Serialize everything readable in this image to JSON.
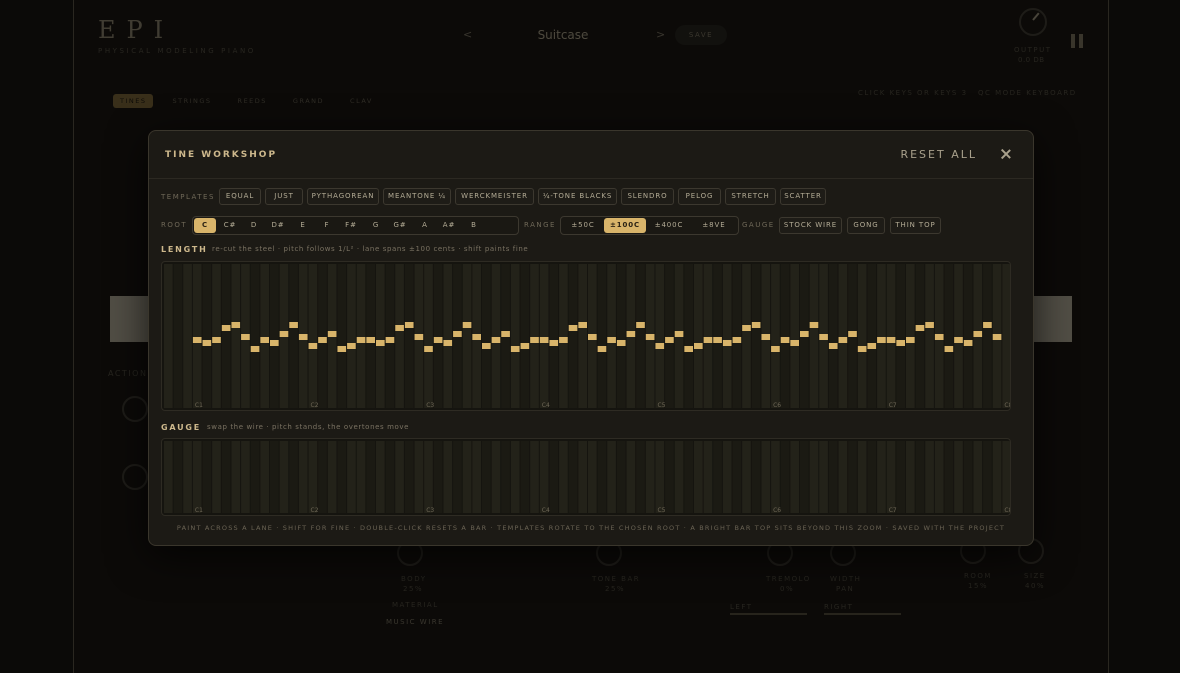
{
  "background": {
    "logo": "EPI",
    "logo_sub": "PHYSICAL MODELING PIANO",
    "preset_prev": "<",
    "preset_next": ">",
    "preset_name": "Suitcase",
    "save_label": "SAVE",
    "output_label": "OUTPUT",
    "output_value": "0.0 dB",
    "categories": [
      {
        "label": "TINES",
        "active": true
      },
      {
        "label": "STRINGS",
        "active": false
      },
      {
        "label": "REEDS",
        "active": false
      },
      {
        "label": "GRAND",
        "active": false
      },
      {
        "label": "CLAV",
        "active": false
      }
    ],
    "right_hint_1": "CLICK KEYS OR KEYS 3",
    "right_hint_2": "QC MODE KEYBOARD",
    "action_label": "ACTION",
    "material_label": "MATERIAL",
    "material_value": "MUSIC WIRE",
    "body_label": "BODY",
    "body_value": "25%",
    "tone_label": "TONE BAR",
    "tone_value": "25%",
    "tremolo_label": "TREMOLO",
    "tremolo_value": "0%",
    "width_label": "WIDTH",
    "width_value": "Pan",
    "room_label": "ROOM",
    "room_value": "15%",
    "size_label": "SIZE",
    "size_value": "40%",
    "left_label": "LEFT",
    "right_label": "RIGHT"
  },
  "modal": {
    "title": "TINE WORKSHOP",
    "reset_label": "RESET ALL",
    "templates_label": "TEMPLATES",
    "templates": [
      {
        "label": "EQUAL",
        "active": false
      },
      {
        "label": "JUST",
        "active": false
      },
      {
        "label": "PYTHAGOREAN",
        "active": false
      },
      {
        "label": "MEANTONE ¼",
        "active": false
      },
      {
        "label": "WERCKMEISTER",
        "active": false
      },
      {
        "label": "¼-TONE BLACKS",
        "active": false
      },
      {
        "label": "SLENDRO",
        "active": false
      },
      {
        "label": "PELOG",
        "active": false
      },
      {
        "label": "STRETCH",
        "active": false
      },
      {
        "label": "SCATTER",
        "active": false
      }
    ],
    "root_label": "ROOT",
    "roots": [
      {
        "label": "C",
        "active": true
      },
      {
        "label": "C#",
        "active": false
      },
      {
        "label": "D",
        "active": false
      },
      {
        "label": "D#",
        "active": false
      },
      {
        "label": "E",
        "active": false
      },
      {
        "label": "F",
        "active": false
      },
      {
        "label": "F#",
        "active": false
      },
      {
        "label": "G",
        "active": false
      },
      {
        "label": "G#",
        "active": false
      },
      {
        "label": "A",
        "active": false
      },
      {
        "label": "A#",
        "active": false
      },
      {
        "label": "B",
        "active": false
      }
    ],
    "range_label": "RANGE",
    "ranges": [
      {
        "label": "±50C",
        "active": false
      },
      {
        "label": "±100C",
        "active": true
      },
      {
        "label": "±400C",
        "active": false
      },
      {
        "label": "±8VE",
        "active": false
      }
    ],
    "gauge_label": "GAUGE",
    "gauges": [
      {
        "label": "STOCK WIRE",
        "active": false
      },
      {
        "label": "GONG",
        "active": false
      },
      {
        "label": "THIN TOP",
        "active": false
      }
    ],
    "length_title": "LENGTH",
    "length_sub": "re-cut the steel · pitch follows 1/L² · lane spans ±100 cents · shift paints fine",
    "gauge_title": "GAUGE",
    "gauge_sub": "swap the wire · pitch stands, the overtones move",
    "octave_labels": [
      "C1",
      "C2",
      "C3",
      "C4",
      "C5",
      "C6",
      "C7",
      "C8"
    ],
    "length_pattern_cents": [
      0,
      -5,
      0,
      20,
      25,
      5,
      -15,
      0,
      -5,
      10,
      25,
      5,
      -10,
      0,
      10,
      -15,
      -10,
      0
    ],
    "footer": "PAINT ACROSS A LANE · SHIFT FOR FINE · DOUBLE-CLICK RESETS A BAR · TEMPLATES ROTATE TO THE CHOSEN ROOT · A BRIGHT BAR TOP SITS BEYOND THIS ZOOM · SAVED WITH THE PROJECT"
  },
  "colors": {
    "accent": "#d8b46a",
    "lane_dark": "#1b1a13",
    "lane_light": "#232219"
  }
}
